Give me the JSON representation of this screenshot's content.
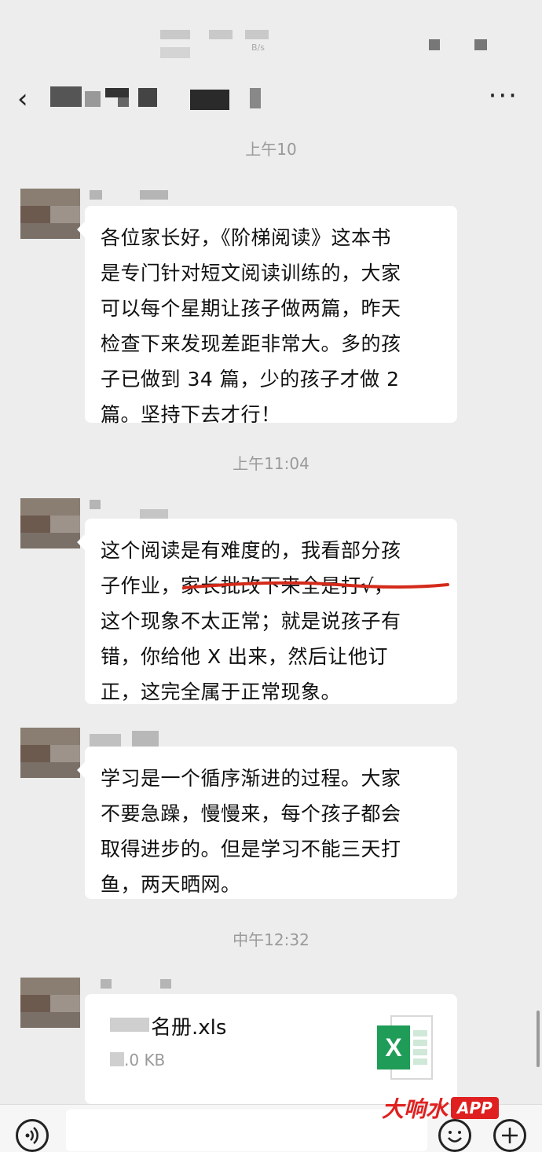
{
  "status_bar": {
    "carrier_text": "B/s"
  },
  "header": {
    "back_icon": "chevron-left-icon",
    "more_label": "···"
  },
  "messages": [
    {
      "time": "上午10",
      "lines": [
        "各位家长好，《阶梯阅读》这本书",
        "是专门针对短文阅读训练的，大家",
        "可以每个星期让孩子做两篇，昨天",
        "检查下来发现差距非常大。多的孩",
        "子已做到 34 篇，少的孩子才做 2",
        "篇。坚持下去才行！"
      ]
    },
    {
      "time": "上午11:04",
      "lines": [
        "这个阅读是有难度的，我看部分孩",
        "子作业，家长批改下来全是打√，",
        "这个现象不太正常；就是说孩子有",
        "错，你给他 X 出来，然后让他订",
        "正，这完全属于正常现象。"
      ]
    },
    {
      "time": "",
      "lines": [
        "学习是一个循序渐进的过程。大家",
        "不要急躁，慢慢来，每个孩子都会",
        "取得进步的。但是学习不能三天打",
        "鱼，两天晒网。"
      ]
    },
    {
      "time": "中午12:32",
      "file": {
        "name": "名册.xls",
        "size": ".0 KB",
        "icon": "excel-icon",
        "icon_letter": "X"
      }
    }
  ],
  "input_bar": {
    "voice_icon": "voice-icon",
    "emoji_icon": "emoji-icon",
    "plus_icon": "plus-icon"
  },
  "watermark": {
    "text": "大响水",
    "app": "APP"
  },
  "colors": {
    "background": "#ededed",
    "bubble": "#ffffff",
    "underline": "#d42a1a",
    "excel_green": "#1f9c57"
  }
}
